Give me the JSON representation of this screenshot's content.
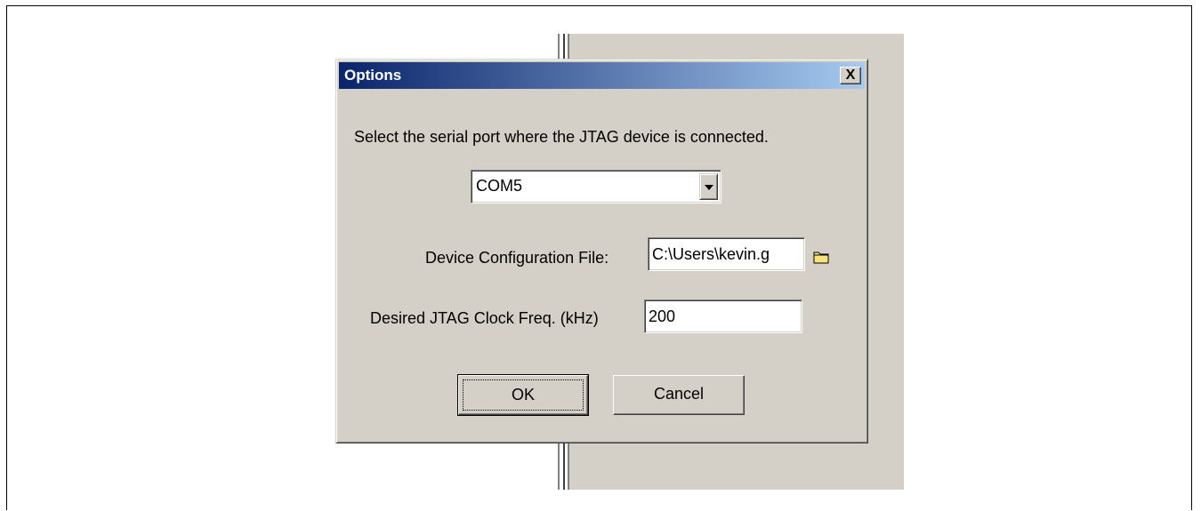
{
  "dialog": {
    "title": "Options",
    "close_label": "X",
    "prompt": "Select the serial port where the JTAG device is connected.",
    "port_select": {
      "value": "COM5"
    },
    "config_file": {
      "label": "Device Configuration File:",
      "value": "C:\\Users\\kevin.g"
    },
    "clock_freq": {
      "label": "Desired JTAG Clock Freq. (kHz)",
      "value": "200"
    },
    "ok_label": "OK",
    "cancel_label": "Cancel"
  },
  "colors": {
    "title_gradient_start": "#0a246a",
    "title_gradient_end": "#a6caf0",
    "dialog_face": "#d4d0c8",
    "folder_icon": "#f7e37a"
  },
  "icons": [
    "close-icon",
    "dropdown-arrow-icon",
    "folder-icon"
  ]
}
